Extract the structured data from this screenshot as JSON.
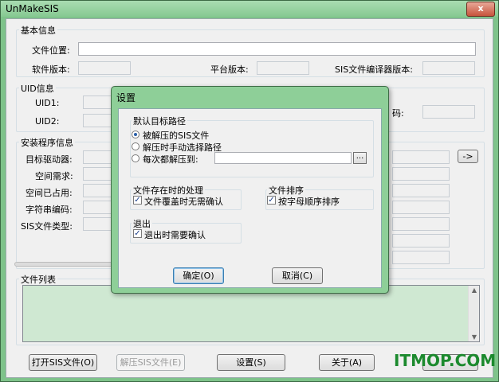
{
  "window": {
    "title": "UnMakeSIS",
    "close_glyph": "x"
  },
  "basic_info": {
    "group_label": "基本信息",
    "file_location_label": "文件位置:",
    "software_version_label": "软件版本:",
    "platform_version_label": "平台版本:",
    "compiler_version_label": "SIS文件编译器版本:"
  },
  "uid_info": {
    "group_label": "UID信息",
    "uid1_label": "UID1:",
    "uid2_label": "UID2:",
    "partial_code_label": "码:"
  },
  "install_info": {
    "group_label": "安装程序信息",
    "target_drive_label": "目标驱动器:",
    "space_required_label": "空间需求:",
    "space_used_label": "空间已占用:",
    "string_encoding_label": "字符串编码:",
    "sis_type_label": "SIS文件类型:",
    "arrow_button": "->"
  },
  "file_list": {
    "group_label": "文件列表"
  },
  "bottom_buttons": {
    "open_sis": "打开SIS文件(O)",
    "extract_sis": "解压SIS文件(E)",
    "settings": "设置(S)",
    "about": "关于(A)"
  },
  "watermark": "ITMOP.COM",
  "settings_dialog": {
    "title": "设置",
    "default_path_group": "默认目标路径",
    "radio_options": [
      {
        "label": "被解压的SIS文件",
        "selected": true
      },
      {
        "label": "解压时手动选择路径",
        "selected": false
      },
      {
        "label": "每次都解压到:",
        "selected": false
      }
    ],
    "browse_label": "...",
    "file_exists_group": "文件存在时的处理",
    "overwrite_no_confirm": {
      "label": "文件覆盖时无需确认",
      "checked": true
    },
    "file_sort_group": "文件排序",
    "sort_alphabetical": {
      "label": "按字母顺序排序",
      "checked": true
    },
    "exit_group": "退出",
    "exit_confirm": {
      "label": "退出时需要确认",
      "checked": true
    },
    "ok_button": "确定(O)",
    "cancel_button": "取消(C)"
  }
}
